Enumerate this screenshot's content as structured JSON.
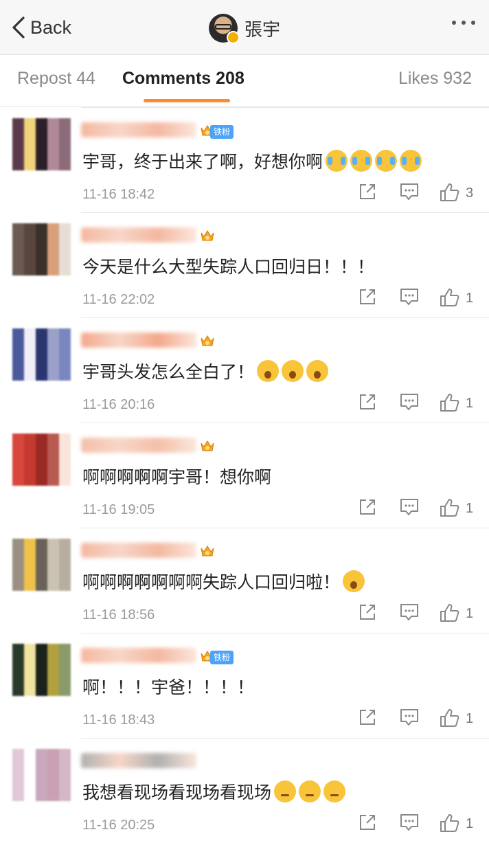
{
  "nav": {
    "back_label": "Back",
    "user_name": "張宇"
  },
  "tabs": [
    {
      "label": "Repost 44"
    },
    {
      "label": "Comments 208"
    },
    {
      "label": "Likes 932"
    }
  ],
  "accent_color": "#fe8a2f",
  "comments": [
    {
      "text": "宇哥，终于出来了啊，好想你啊",
      "emojis": [
        "cry",
        "cry",
        "cry",
        "cry"
      ],
      "time": "11-16 18:42",
      "likes": "3",
      "badge": "铁粉"
    },
    {
      "text": "今天是什么大型失踪人口回归日！！！",
      "emojis": [],
      "time": "11-16 22:02",
      "likes": "1",
      "badge": ""
    },
    {
      "text": "宇哥头发怎么全白了！",
      "emojis": [
        "shock",
        "shock",
        "shock"
      ],
      "time": "11-16 20:16",
      "likes": "1",
      "badge": ""
    },
    {
      "text": "啊啊啊啊啊宇哥！想你啊",
      "emojis": [],
      "time": "11-16 19:05",
      "likes": "1",
      "badge": ""
    },
    {
      "text": "啊啊啊啊啊啊啊失踪人口回归啦！",
      "emojis": [
        "shock"
      ],
      "time": "11-16 18:56",
      "likes": "1",
      "badge": ""
    },
    {
      "text": "啊！！！宇爸！！！！",
      "emojis": [],
      "time": "11-16 18:43",
      "likes": "1",
      "badge": "铁粉"
    },
    {
      "text": "我想看现场看现场看现场",
      "emojis": [
        "roll",
        "roll",
        "roll"
      ],
      "time": "11-16 20:25",
      "likes": "1",
      "badge": ""
    }
  ]
}
